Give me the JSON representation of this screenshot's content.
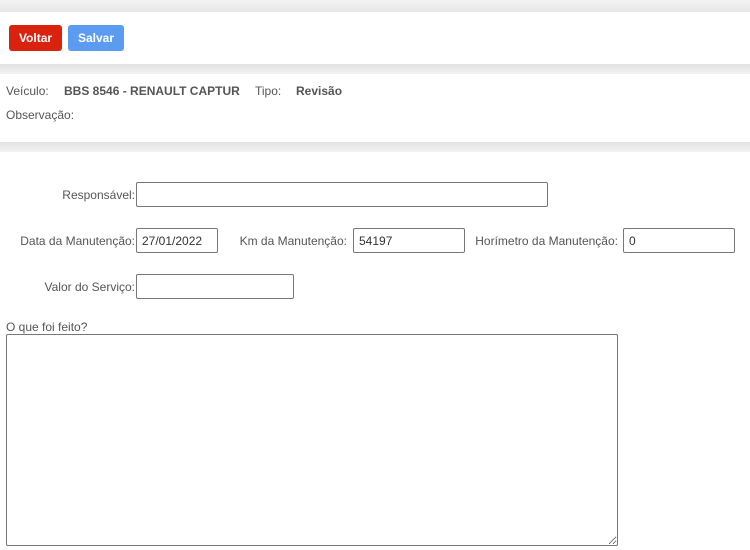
{
  "toolbar": {
    "voltar_label": "Voltar",
    "salvar_label": "Salvar",
    "voltar_color": "#d9230f",
    "salvar_color": "#5b9bf0"
  },
  "info": {
    "veiculo_label": "Veículo:",
    "veiculo_value": "BBS 8546 - RENAULT CAPTUR",
    "tipo_label": "Tipo:",
    "tipo_value": "Revisão",
    "observacao_label": "Observação:"
  },
  "form": {
    "responsavel_label": "Responsável:",
    "responsavel_value": "",
    "data_label": "Data da Manutenção:",
    "data_value": "27/01/2022",
    "km_label": "Km da Manutenção:",
    "km_value": "54197",
    "horimetro_label": "Horímetro da Manutenção:",
    "horimetro_value": "0",
    "valor_label": "Valor do Serviço:",
    "valor_value": "",
    "oque_label": "O que foi feito?",
    "oque_value": ""
  }
}
